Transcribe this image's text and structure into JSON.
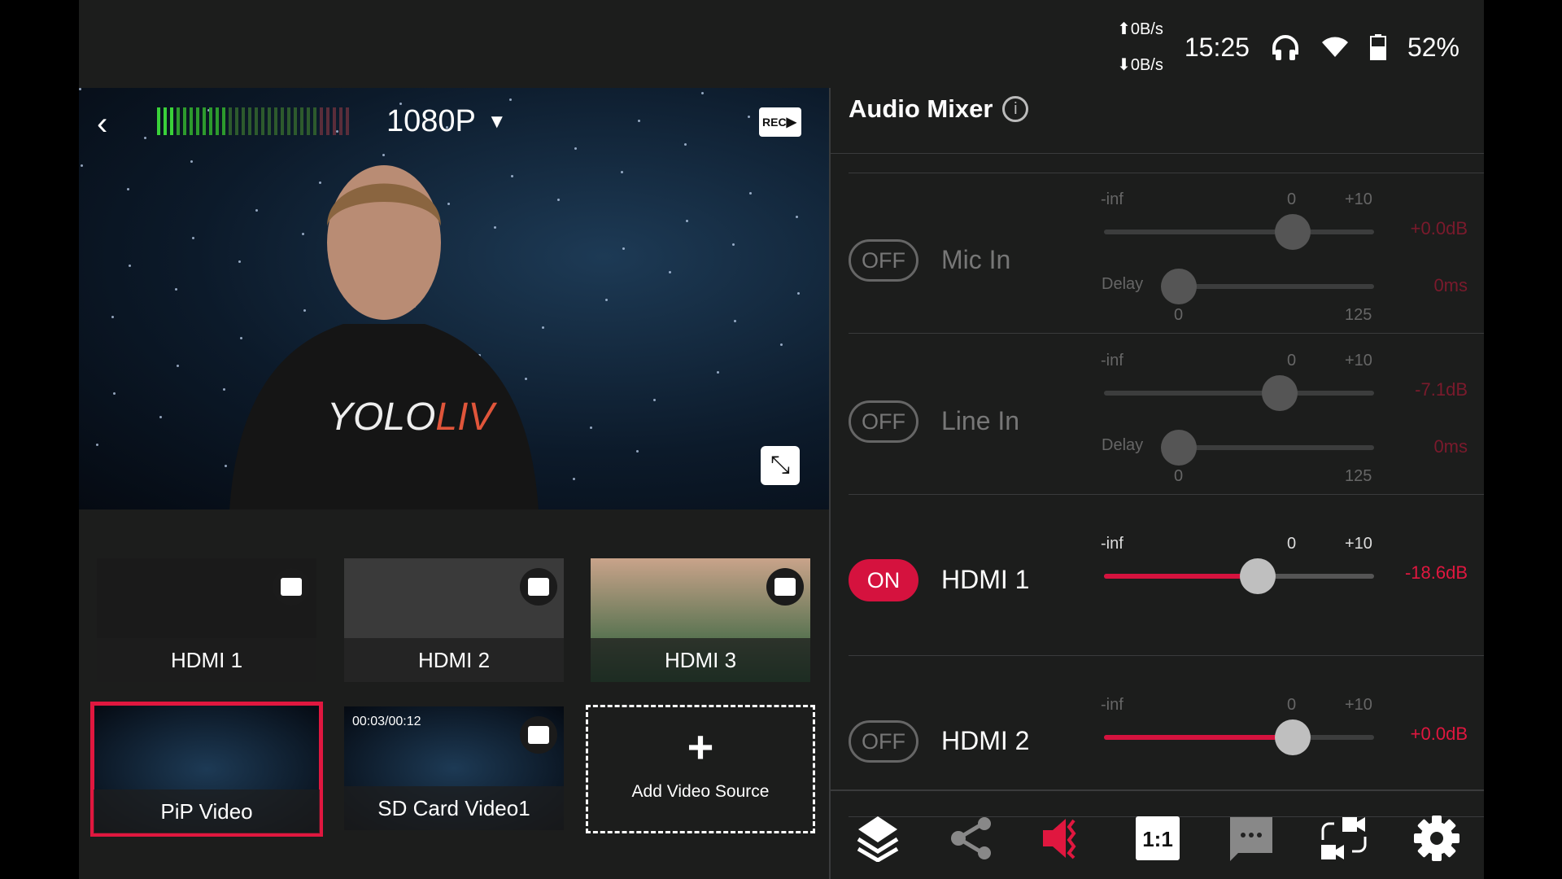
{
  "status": {
    "upload_rate": "0B/s",
    "download_rate": "0B/s",
    "time": "15:25",
    "battery": "52%",
    "icons": [
      "headphones-icon",
      "wifi-icon",
      "battery-icon"
    ]
  },
  "preview": {
    "resolution": "1080P",
    "rec_label": "REC",
    "audio_meter_level": 0.35
  },
  "sources": [
    {
      "label": "HDMI 1"
    },
    {
      "label": "HDMI 2"
    },
    {
      "label": "HDMI 3"
    },
    {
      "label": "PiP Video",
      "selected": true
    },
    {
      "label": "SD Card Video1",
      "timecode": "00:03/00:12"
    }
  ],
  "add_source": {
    "label": "Add Video Source",
    "icon": "+"
  },
  "mixer": {
    "title": "Audio Mixer",
    "scale": {
      "min": "-inf",
      "mid": "0",
      "max": "+10"
    },
    "delay_label": "Delay",
    "delay_scale": {
      "min": "0",
      "max": "125"
    },
    "channels": [
      {
        "name": "Mic In",
        "state": "OFF",
        "gain": "+0.0dB",
        "level": 0.7,
        "delay": "0ms",
        "delay_level": 0
      },
      {
        "name": "Line In",
        "state": "OFF",
        "gain": "-7.1dB",
        "level": 0.65,
        "delay": "0ms",
        "delay_level": 0
      },
      {
        "name": "HDMI 1",
        "state": "ON",
        "gain": "-18.6dB",
        "level": 0.57
      },
      {
        "name": "HDMI 2",
        "state": "OFF",
        "gain": "+0.0dB",
        "level": 0.7
      }
    ]
  },
  "toolbar": {
    "ratio_label": "1:1",
    "accent": "#e0173f",
    "icons": [
      "layers-icon",
      "share-icon",
      "audio-icon",
      "ratio-icon",
      "comment-icon",
      "switch-camera-icon",
      "settings-icon"
    ]
  }
}
